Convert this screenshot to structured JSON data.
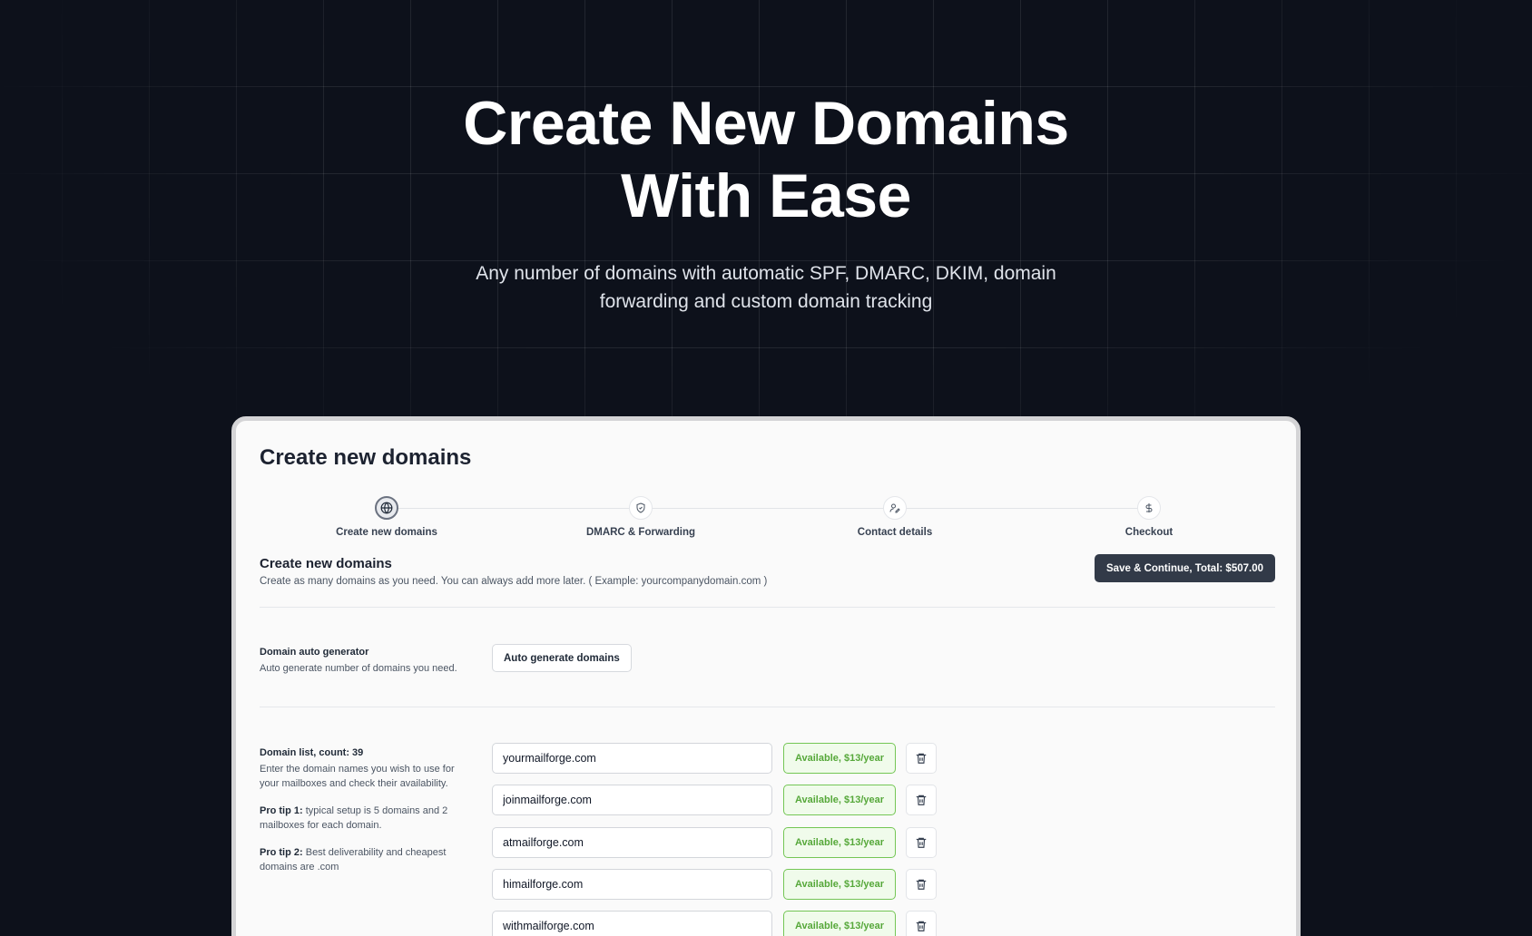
{
  "hero": {
    "title_line1": "Create New Domains",
    "title_line2": "With Ease",
    "subtitle_line1": "Any number of domains with automatic SPF, DMARC, DKIM, domain",
    "subtitle_line2": "forwarding and custom domain tracking"
  },
  "card": {
    "title": "Create new domains",
    "steps": [
      {
        "label": "Create new domains",
        "icon": "globe-icon",
        "active": true
      },
      {
        "label": "DMARC & Forwarding",
        "icon": "shield-check-icon",
        "active": false
      },
      {
        "label": "Contact details",
        "icon": "user-pen-icon",
        "active": false
      },
      {
        "label": "Checkout",
        "icon": "dollar-icon",
        "active": false
      }
    ],
    "section_title": "Create new domains",
    "section_desc": "Create as many domains as you need. You can always add more later. ( Example: yourcompanydomain.com )",
    "save_button": "Save & Continue, Total: $507.00",
    "auto_gen": {
      "label": "Domain auto generator",
      "desc": "Auto generate number of domains you need.",
      "button": "Auto generate domains"
    },
    "domain_list": {
      "label": "Domain list, count: 39",
      "desc": "Enter the domain names you wish to use for your mailboxes and check their availability.",
      "tip1_bold": "Pro tip 1:",
      "tip1_text": " typical setup is 5 domains and 2 mailboxes for each domain.",
      "tip2_bold": "Pro tip 2:",
      "tip2_text": " Best deliverability and cheapest domains are .com",
      "items": [
        {
          "domain": "yourmailforge.com",
          "status": "Available, $13/year"
        },
        {
          "domain": "joinmailforge.com",
          "status": "Available, $13/year"
        },
        {
          "domain": "atmailforge.com",
          "status": "Available, $13/year"
        },
        {
          "domain": "himailforge.com",
          "status": "Available, $13/year"
        },
        {
          "domain": "withmailforge.com",
          "status": "Available, $13/year"
        }
      ]
    }
  },
  "colors": {
    "background": "#0d111b",
    "primary_button": "#323a48",
    "available_green": "#56a83a"
  }
}
